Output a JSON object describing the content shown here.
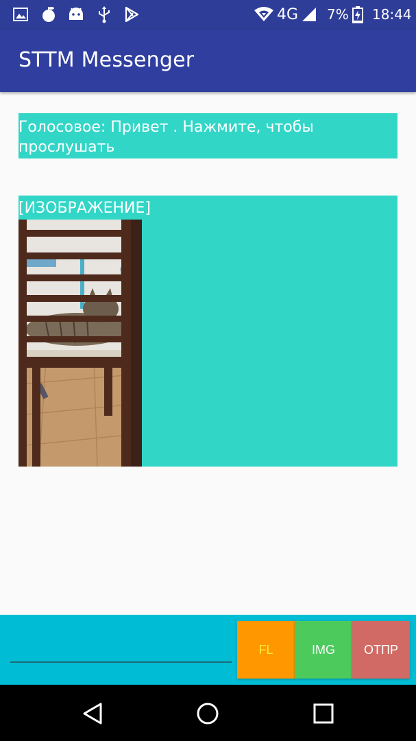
{
  "status_bar": {
    "network": "4G",
    "battery": "7%",
    "time": "18:44",
    "left_icons": [
      "gallery-icon",
      "apple-icon",
      "android-icon",
      "usb-icon",
      "play-store-icon"
    ],
    "right_icons": [
      "wifi-icon",
      "signal-icon",
      "battery-charging-icon"
    ]
  },
  "app_bar": {
    "title": "STTM Messenger"
  },
  "messages": [
    {
      "type": "voice",
      "text": "Голосовое: Привет . Нажмите, чтобы прослушать"
    },
    {
      "type": "image",
      "label": "[ИЗОБРАЖЕНИЕ]"
    }
  ],
  "composer": {
    "value": "",
    "placeholder": "",
    "buttons": {
      "file": "FL",
      "image": "IMG",
      "send": "ОТПР"
    }
  },
  "nav": {
    "icons": [
      "back-icon",
      "home-icon",
      "recents-icon"
    ]
  },
  "colors": {
    "status_bar": "#2e3d97",
    "app_bar": "#303f9f",
    "message_bg": "#32d6c7",
    "bottom_bar": "#00bcd4",
    "btn_file": "#ff9800",
    "btn_image": "#4cca5c",
    "btn_send": "#d16a64"
  }
}
